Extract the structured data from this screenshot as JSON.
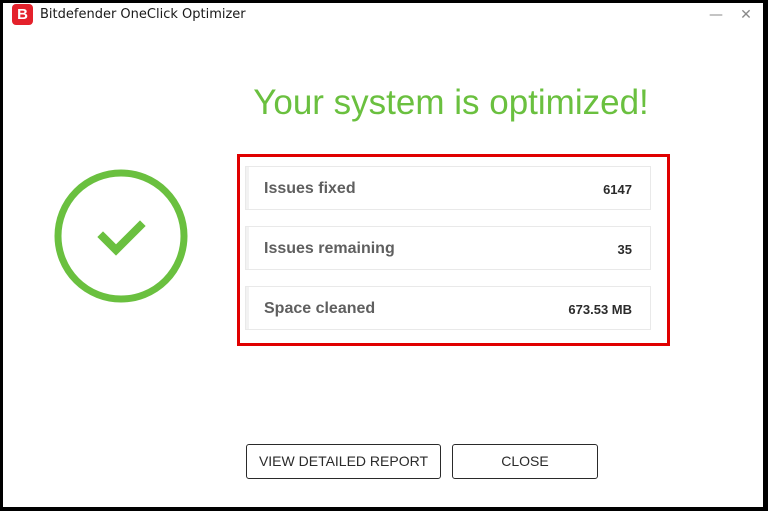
{
  "window": {
    "title": "Bitdefender OneClick Optimizer",
    "logo_letter": "B",
    "logo_icon": "bitdefender-logo-icon",
    "minimize_glyph": "—",
    "close_glyph": "✕",
    "brand_color": "#e4212b"
  },
  "main": {
    "headline": "Your system is optimized!",
    "status_icon": "checkmark-circle-icon",
    "accent_color": "#6ac03f",
    "highlight_color": "#e00000",
    "stats": [
      {
        "label": "Issues fixed",
        "value": "6147"
      },
      {
        "label": "Issues remaining",
        "value": "35"
      },
      {
        "label": "Space cleaned",
        "value": "673.53 MB"
      }
    ]
  },
  "actions": {
    "report_label": "VIEW DETAILED REPORT",
    "close_label": "CLOSE"
  }
}
